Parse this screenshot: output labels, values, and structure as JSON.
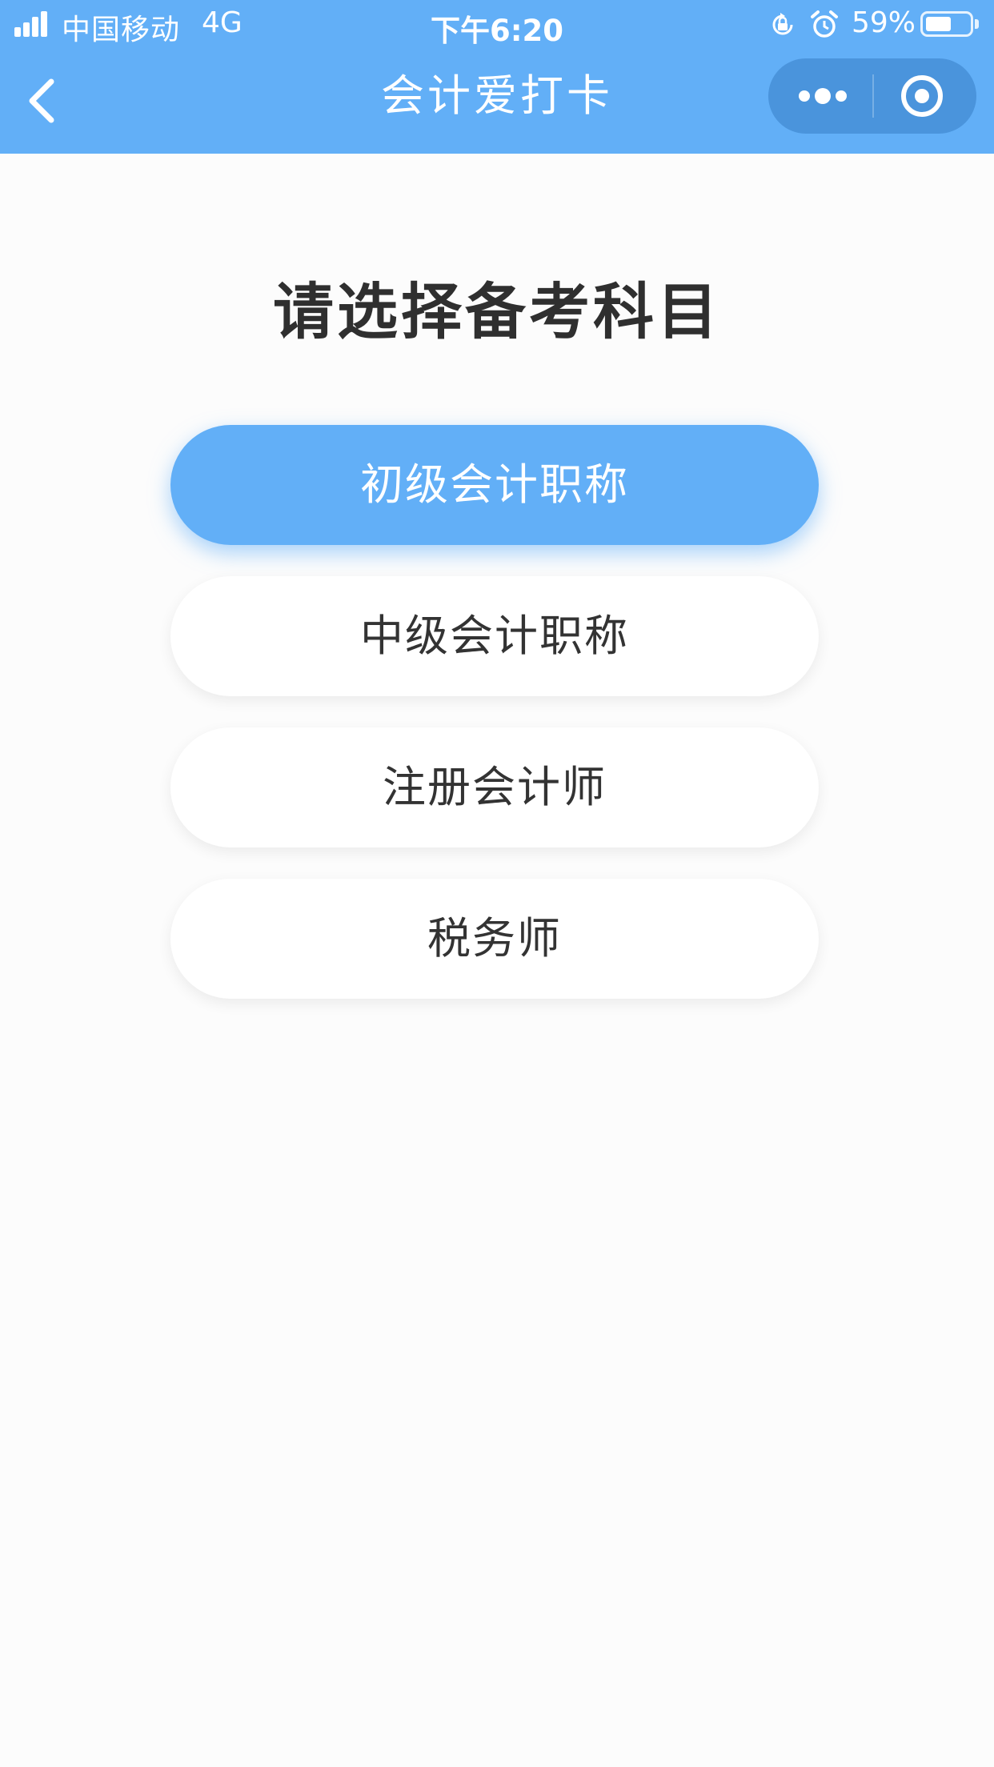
{
  "status_bar": {
    "carrier": "中国移动",
    "network": "4G",
    "time": "下午6:20",
    "battery_percent": "59%",
    "battery_level": 0.59
  },
  "nav": {
    "title": "会计爱打卡",
    "back_icon": "chevron-left-icon",
    "more_icon": "more-dots-icon",
    "close_icon": "target-close-icon"
  },
  "page": {
    "heading": "请选择备考科目",
    "options": [
      {
        "label": "初级会计职称",
        "selected": true
      },
      {
        "label": "中级会计职称",
        "selected": false
      },
      {
        "label": "注册会计师",
        "selected": false
      },
      {
        "label": "税务师",
        "selected": false
      }
    ]
  },
  "colors": {
    "accent": "#62aff7",
    "capsule": "#4a94dc",
    "text": "#333333",
    "background": "#fcfcfc"
  }
}
